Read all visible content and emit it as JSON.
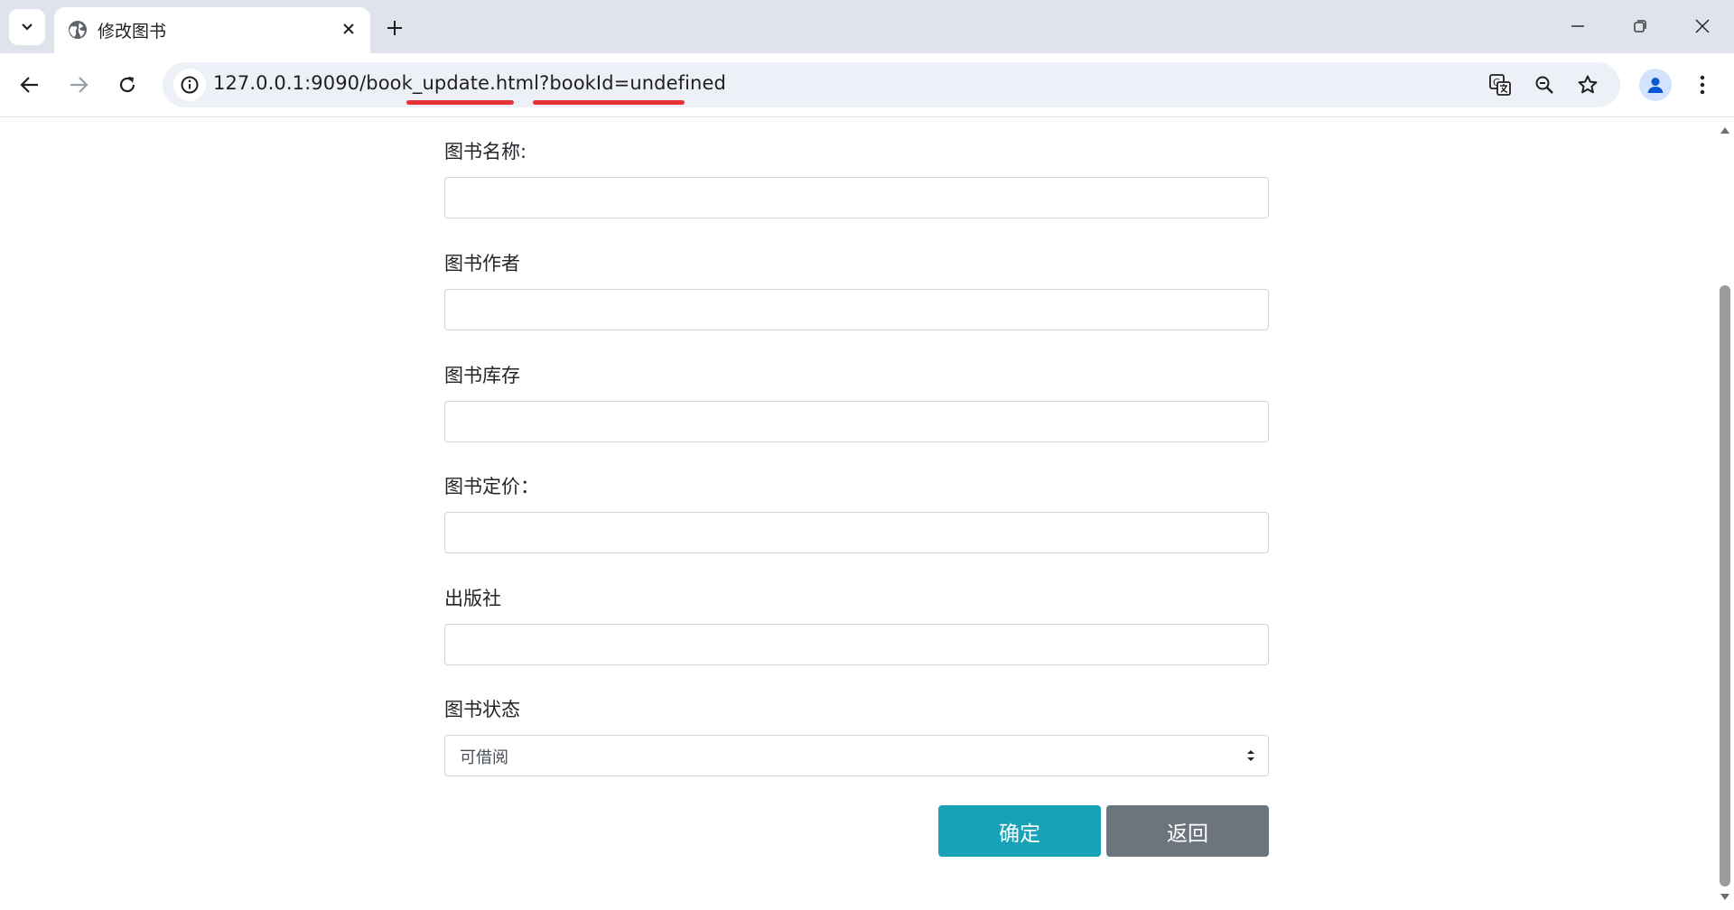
{
  "browser": {
    "tab": {
      "title": "修改图书"
    },
    "address_bar": {
      "url_host": "127.0.0.1:9090/",
      "url_path": "book_update.html?bookId=undefined"
    },
    "icons": {
      "tab_search": "chevron-down-icon",
      "favicon": "globe-icon",
      "tab_close": "close-icon",
      "new_tab": "plus-icon",
      "minimize": "minimize-icon",
      "restore": "restore-icon",
      "close_window": "close-icon",
      "back": "arrow-left-icon",
      "forward": "arrow-right-icon",
      "reload": "reload-icon",
      "site_info": "info-icon",
      "translate": "translate-icon",
      "zoom": "zoom-out-icon",
      "bookmark": "star-icon",
      "profile": "person-icon",
      "menu": "more-vert-icon"
    },
    "annotation_color": "#e53238"
  },
  "form": {
    "fields": [
      {
        "label": "图书名称:",
        "value": ""
      },
      {
        "label": "图书作者",
        "value": ""
      },
      {
        "label": "图书库存",
        "value": ""
      },
      {
        "label": "图书定价：",
        "value": ""
      },
      {
        "label": "出版社",
        "value": ""
      }
    ],
    "status": {
      "label": "图书状态",
      "selected": "可借阅"
    },
    "buttons": {
      "confirm": "确定",
      "back": "返回"
    }
  },
  "colors": {
    "confirm_button": "#17a2b8",
    "back_button": "#6c757d"
  }
}
